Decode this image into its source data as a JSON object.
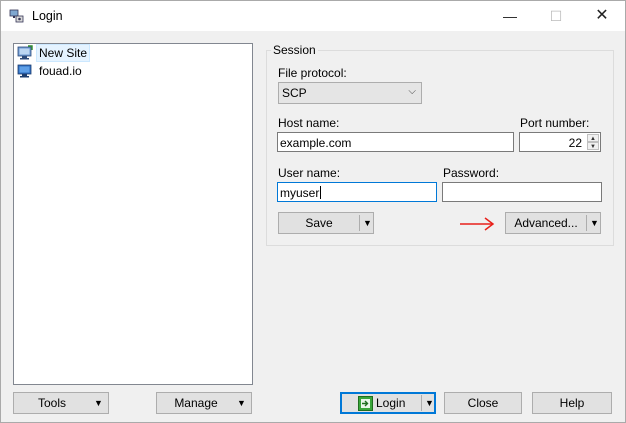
{
  "window": {
    "title": "Login",
    "controls": {
      "minimize": "—",
      "maximize": "☐",
      "close": "✕"
    }
  },
  "sites": [
    {
      "label": "New Site",
      "icon": "new-site-icon",
      "selected": true
    },
    {
      "label": "fouad.io",
      "icon": "monitor-icon",
      "selected": false
    }
  ],
  "session": {
    "group_label": "Session",
    "file_protocol_label": "File protocol:",
    "file_protocol_value": "SCP",
    "host_name_label": "Host name:",
    "host_name_value": "example.com",
    "port_number_label": "Port number:",
    "port_number_value": "22",
    "user_name_label": "User name:",
    "user_name_value": "myuser",
    "password_label": "Password:",
    "password_value": "",
    "save_label": "Save",
    "advanced_label": "Advanced..."
  },
  "bottom": {
    "tools_label": "Tools",
    "manage_label": "Manage",
    "login_label": "Login",
    "close_label": "Close",
    "help_label": "Help"
  },
  "colors": {
    "accent": "#0078d7",
    "annotation_arrow": "#e8201a",
    "login_icon": "#3aa63a"
  }
}
